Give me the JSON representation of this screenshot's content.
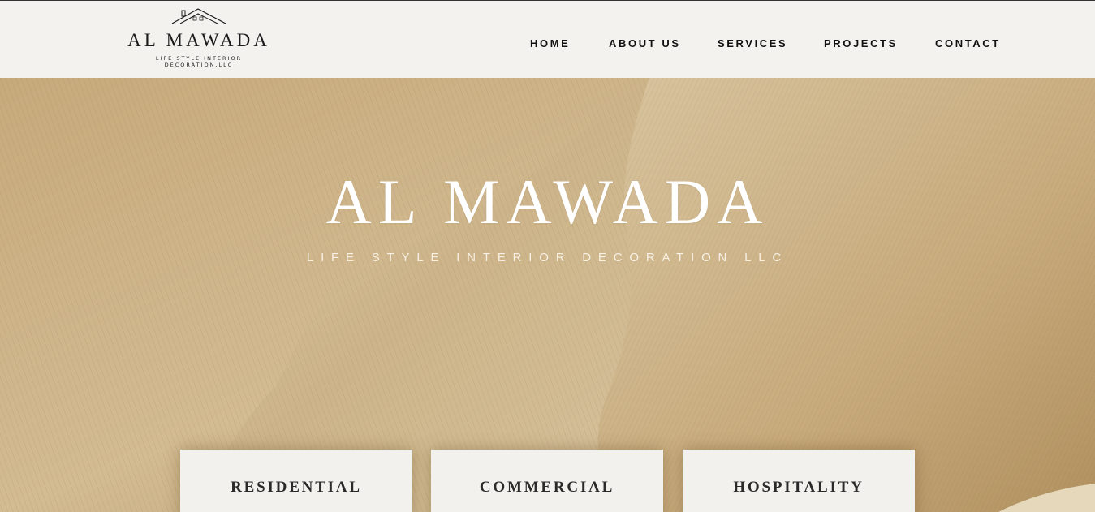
{
  "brand": {
    "name": "AL MAWADA",
    "tagline_line1": "LIFE STYLE INTERIOR",
    "tagline_line2": "DECORATION,LLC"
  },
  "nav": {
    "items": [
      {
        "label": "HOME"
      },
      {
        "label": "ABOUT US"
      },
      {
        "label": "SERVICES"
      },
      {
        "label": "PROJECTS"
      },
      {
        "label": "CONTACT"
      }
    ]
  },
  "hero": {
    "title": "AL MAWADA",
    "subtitle": "LIFE STYLE INTERIOR DECORATION LLC"
  },
  "cards": [
    {
      "title": "RESIDENTIAL"
    },
    {
      "title": "COMMERCIAL"
    },
    {
      "title": "HOSPITALITY"
    }
  ],
  "colors": {
    "header_bg": "#f3f2ef",
    "hero_sand": "#c9ad80",
    "text_dark": "#111111",
    "card_bg": "#f2f1ee"
  },
  "icons": {
    "logo": "house-roof-icon"
  }
}
